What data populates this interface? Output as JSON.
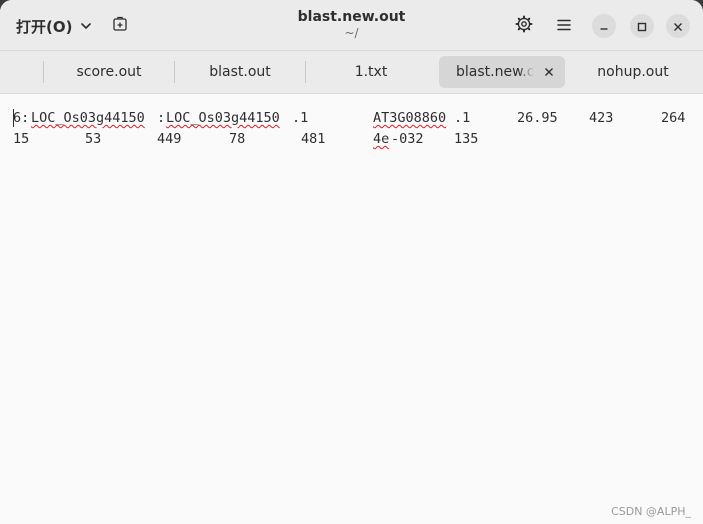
{
  "header": {
    "open_label": "打开(O)",
    "title": "blast.new.out",
    "subtitle": "~/"
  },
  "tabs": [
    {
      "label": "score.out",
      "active": false
    },
    {
      "label": "blast.out",
      "active": false
    },
    {
      "label": "1.txt",
      "active": false
    },
    {
      "label": "blast.new.out",
      "active": true
    },
    {
      "label": "nohup.out",
      "active": false
    }
  ],
  "editor": {
    "line1": {
      "col1_prefix": "6:",
      "col1_locus_a": "LOC_Os03g44150",
      "col1_sep": ":",
      "col1_locus_b": "LOC_Os03g44150",
      "col1_suffix": ".1",
      "col2_id": "AT3G08860",
      "col2_suffix": ".1",
      "col3": "26.95",
      "col4": "423",
      "col5": "264"
    },
    "line2": {
      "c1": "15",
      "c2": "53",
      "c3": "449",
      "c4": "78",
      "c5": "481",
      "c6_a": "4e",
      "c6_b": "-032",
      "c7": "135"
    }
  },
  "watermark": "CSDN @ALPH_",
  "colors": {
    "headerbar": "#ebebeb",
    "editor_bg": "#fafafa",
    "active_tab": "#d6d6d6",
    "spell_underline": "#e01b24"
  }
}
